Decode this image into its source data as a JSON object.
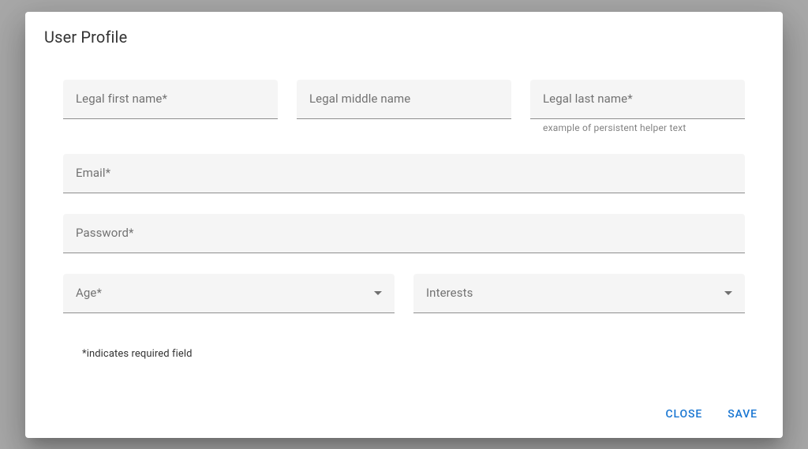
{
  "dialog": {
    "title": "User Profile",
    "required_note": "*indicates required field",
    "actions": {
      "close_label": "CLOSE",
      "save_label": "SAVE"
    }
  },
  "form": {
    "first_name": {
      "label": "Legal first name*",
      "value": ""
    },
    "middle_name": {
      "label": "Legal middle name",
      "value": ""
    },
    "last_name": {
      "label": "Legal last name*",
      "value": "",
      "helper": "example of persistent helper text"
    },
    "email": {
      "label": "Email*",
      "value": ""
    },
    "password": {
      "label": "Password*",
      "value": ""
    },
    "age": {
      "label": "Age*",
      "selected": ""
    },
    "interests": {
      "label": "Interests",
      "selected": ""
    }
  }
}
